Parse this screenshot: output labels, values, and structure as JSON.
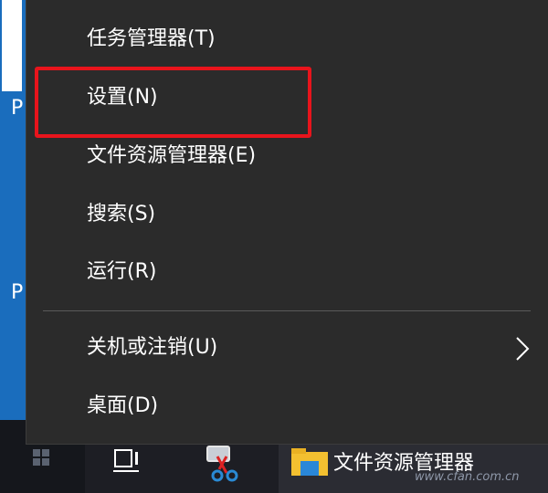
{
  "desktop": {
    "glyph_1": "P",
    "glyph_2": "P"
  },
  "context_menu": {
    "items": [
      {
        "label": "任务管理器(T)",
        "icon": "none",
        "has_submenu": false
      },
      {
        "label": "设置(N)",
        "icon": "none",
        "has_submenu": false,
        "annotated": true
      },
      {
        "label": "文件资源管理器(E)",
        "icon": "none",
        "has_submenu": false
      },
      {
        "label": "搜索(S)",
        "icon": "none",
        "has_submenu": false
      },
      {
        "label": "运行(R)",
        "icon": "none",
        "has_submenu": false
      },
      {
        "label": "关机或注销(U)",
        "icon": "chevron-right-icon",
        "has_submenu": true
      },
      {
        "label": "桌面(D)",
        "icon": "none",
        "has_submenu": false
      }
    ]
  },
  "taskbar": {
    "start_icon": "windows-logo-icon",
    "task_view_icon": "task-view-icon",
    "snip_icon": "scissors-icon",
    "explorer": {
      "icon": "folder-icon",
      "label": "文件资源管理器"
    }
  },
  "watermark": {
    "text": "www.cfan.com.cn"
  },
  "colors": {
    "menu_background": "#2b2b2b",
    "menu_text": "#ffffff",
    "separator": "#5a5a5a",
    "highlight": "#e8141c",
    "desktop_blue": "#1a6dbd",
    "taskbar": "#1d1e24"
  }
}
